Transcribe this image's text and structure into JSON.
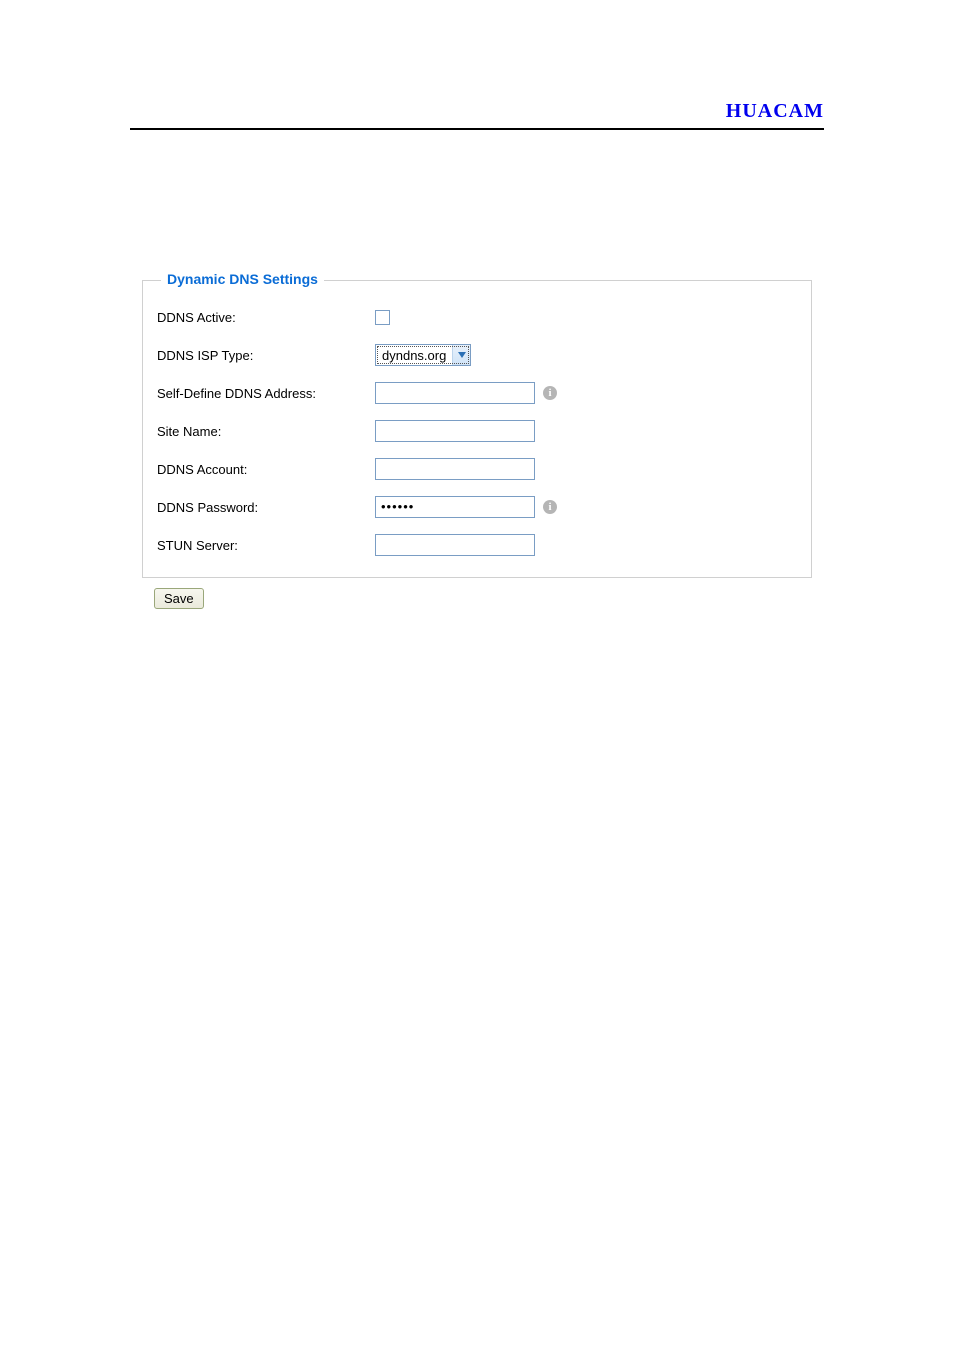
{
  "brand": "HUACAM",
  "fieldset": {
    "legend": "Dynamic DNS Settings",
    "rows": {
      "ddns_active": {
        "label": "DDNS Active:",
        "checked": false
      },
      "ddns_isp_type": {
        "label": "DDNS ISP Type:",
        "value": "dyndns.org"
      },
      "self_define_addr": {
        "label": "Self-Define DDNS Address:",
        "value": ""
      },
      "site_name": {
        "label": "Site Name:",
        "value": ""
      },
      "ddns_account": {
        "label": "DDNS Account:",
        "value": ""
      },
      "ddns_password": {
        "label": "DDNS Password:",
        "value": "••••••"
      },
      "stun_server": {
        "label": "STUN Server:",
        "value": ""
      }
    }
  },
  "buttons": {
    "save": "Save"
  },
  "info_glyph": "i"
}
